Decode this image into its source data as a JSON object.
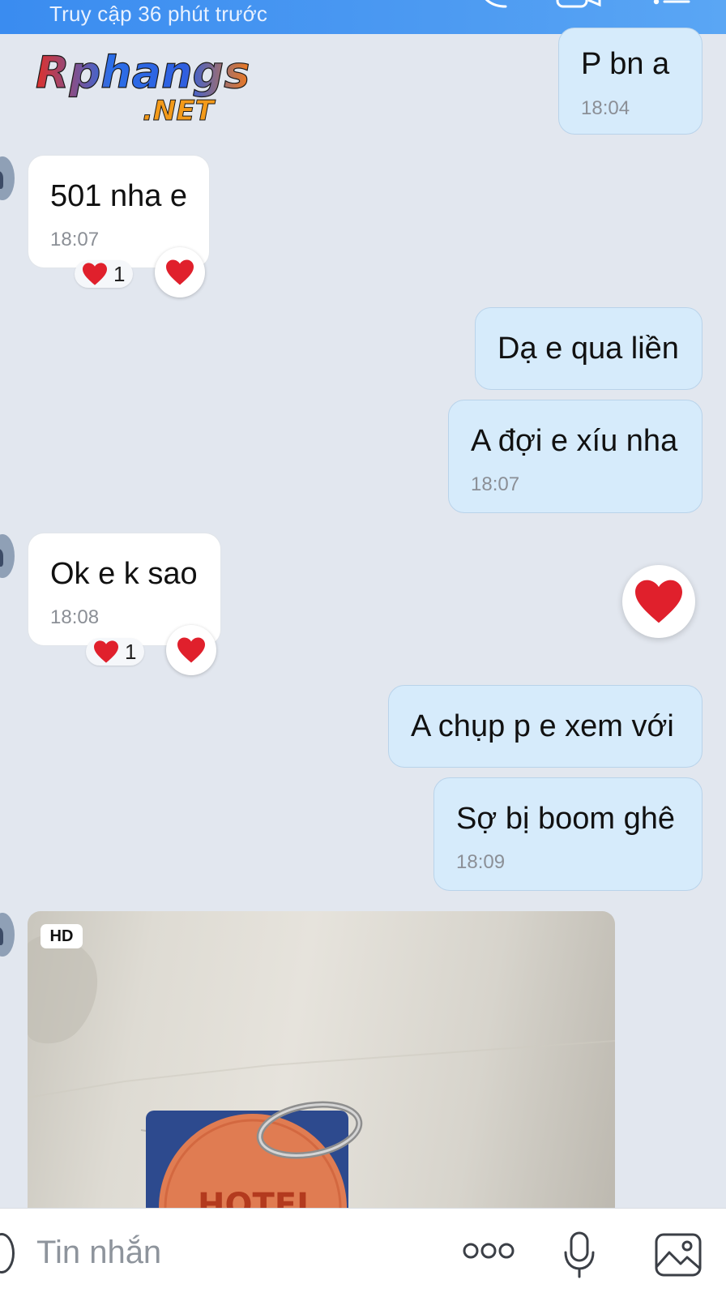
{
  "header": {
    "status": "Truy cập 36 phút trước"
  },
  "logo": {
    "brand": "Rphangs",
    "tld": ".NET"
  },
  "messages": [
    {
      "side": "out",
      "text": "P bn a",
      "time": "18:04"
    },
    {
      "side": "in",
      "text": "501 nha e",
      "time": "18:07",
      "reaction_count": "1"
    },
    {
      "side": "out",
      "text": "Dạ e qua liền"
    },
    {
      "side": "out",
      "text": "A đợi e xíu nha",
      "time": "18:07"
    },
    {
      "side": "in",
      "text": "Ok e k sao",
      "time": "18:08",
      "reaction_count": "1"
    },
    {
      "side": "out",
      "text": "A chụp p e xem với"
    },
    {
      "side": "out",
      "text": "Sợ bị boom ghê",
      "time": "18:09"
    },
    {
      "side": "in",
      "type": "photo",
      "badge": "HD"
    }
  ],
  "composer": {
    "placeholder": "Tin nhắn"
  },
  "colors": {
    "header": "#4a98f2",
    "background": "#e2e7ef",
    "incoming_bubble": "#ffffff",
    "outgoing_bubble": "#d6ebfb",
    "heart": "#e0202c"
  },
  "icons": [
    "phone-icon",
    "video-call-icon",
    "menu-icon",
    "avatar",
    "heart-icon",
    "emoji-icon",
    "more-icon",
    "microphone-icon",
    "image-icon"
  ]
}
